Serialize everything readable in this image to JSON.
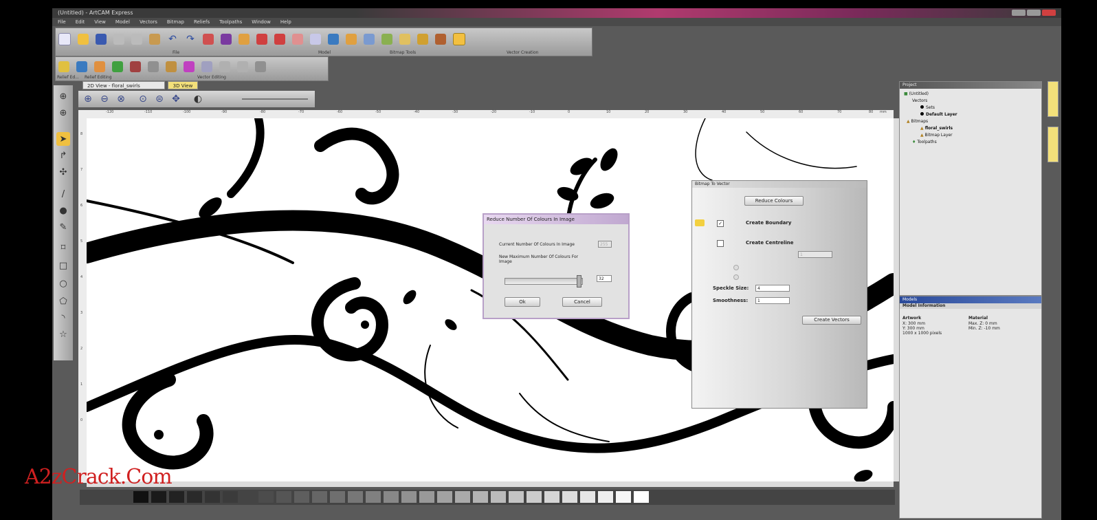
{
  "window": {
    "title": "(Untitled) - ArtCAM Express"
  },
  "menu": [
    "File",
    "Edit",
    "View",
    "Model",
    "Vectors",
    "Bitmap",
    "Reliefs",
    "Toolpaths",
    "Window",
    "Help"
  ],
  "toolbar": {
    "groups": [
      {
        "caption": "File"
      },
      {
        "caption": "Model"
      },
      {
        "caption": "Bitmap Tools"
      },
      {
        "caption": "Vector Creation"
      }
    ],
    "row2_captions": [
      "Relief Ed...",
      "Relief Editing",
      "Vector Editing"
    ]
  },
  "tabs": {
    "view2d": "2D View - floral_swirls",
    "view3d": "3D View"
  },
  "ruler": {
    "h_ticks": [
      "-120",
      "-110",
      "-100",
      "-90",
      "-80",
      "-70",
      "-60",
      "-50",
      "-40",
      "-30",
      "-20",
      "-10",
      "0",
      "10",
      "20",
      "30",
      "40",
      "50",
      "60",
      "70",
      "80",
      "90"
    ],
    "units": "mm",
    "v_ticks": [
      "8",
      "7",
      "6",
      "5",
      "4",
      "3",
      "2",
      "1",
      "0"
    ]
  },
  "palette": {
    "colors": [
      "#111111",
      "#1a1a1a",
      "#222222",
      "#2a2a2a",
      "#333333",
      "#3b3b3b",
      "#444444",
      "#4c4c4c",
      "#555555",
      "#5e5e5e",
      "#666666",
      "#6f6f6f",
      "#777777",
      "#808080",
      "#888888",
      "#919191",
      "#999999",
      "#a2a2a2",
      "#aaaaaa",
      "#b3b3b3",
      "#bbbbbb",
      "#c4c4c4",
      "#cccccc",
      "#d5d5d5",
      "#dddddd",
      "#e6e6e6",
      "#eeeeee",
      "#f7f7f7",
      "#ffffff"
    ]
  },
  "project": {
    "title": "Project",
    "root": "(Untitled)",
    "vectors": "Vectors",
    "vector_layers": [
      "Sets",
      "Default Layer"
    ],
    "bitmaps": "Bitmaps",
    "bitmap_layers": [
      "floral_swirls",
      "Bitmap Layer"
    ],
    "toolpaths": "Toolpaths"
  },
  "models": {
    "title": "Models",
    "subtitle": "Model Information",
    "artwork_head": "Artwork",
    "artwork_lines": [
      "X: 300 mm",
      "Y: 300 mm",
      "1000 x 1000 pixels"
    ],
    "material_head": "Material",
    "material_lines": [
      "Max. Z: 0 mm",
      "Min. Z: -10 mm"
    ]
  },
  "bitmap_to_vector": {
    "title": "Bitmap To Vector",
    "reduce_colours": "Reduce Colours",
    "create_boundary": "Create Boundary",
    "create_centreline": "Create Centreline",
    "line_thickness_value": "1",
    "speckle_label": "Speckle Size:",
    "speckle_value": "4",
    "smoothness_label": "Smoothness:",
    "smoothness_value": "1",
    "create_vectors": "Create Vectors"
  },
  "reduce_dialog": {
    "title": "Reduce Number Of Colours In Image",
    "current_label": "Current Number Of Colours In Image",
    "current_value": "255",
    "new_label": "New Maximum Number Of Colours For Image",
    "new_value": "32",
    "ok": "Ok",
    "cancel": "Cancel"
  },
  "watermark": "A2zCrack.Com",
  "colors": {
    "accent": "#f3e07a",
    "title_pink": "#b03a6e",
    "models_blue": "#2a4a9a"
  }
}
